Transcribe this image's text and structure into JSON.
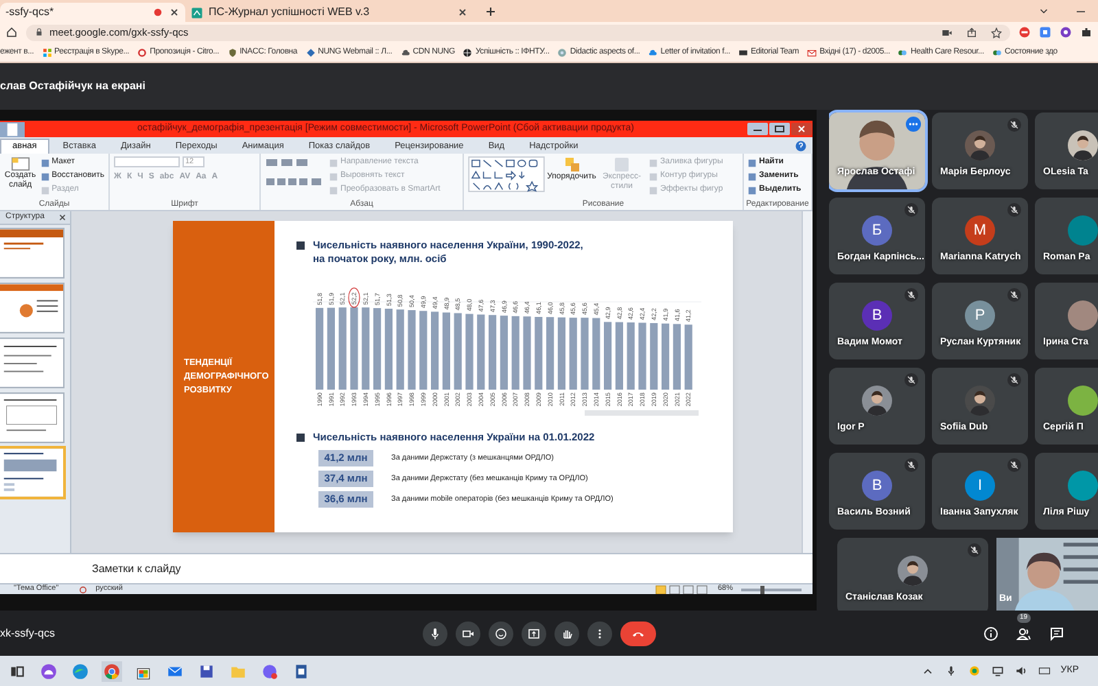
{
  "browser": {
    "tabs": [
      {
        "title": "-ssfy-qcs*",
        "recording": true,
        "selected": true
      },
      {
        "title": "ПС-Журнал успішності WEB v.3",
        "recording": false,
        "selected": false
      }
    ],
    "address": "meet.google.com/gxk-ssfy-qcs",
    "bookmarks": [
      "ежент в...",
      "Реєстрація в Skype...",
      "Пропозиція - Citro...",
      "INACC: Головна",
      "NUNG Webmail :: Л...",
      "CDN NUNG",
      "Успішність :: ІФНТУ...",
      "Didactic aspects of...",
      "Letter of invitation f...",
      "Editorial Team",
      "Вхідні (17) - d2005...",
      "Health Care Resour...",
      "Состояние здо"
    ]
  },
  "meet": {
    "presenting_label": "слав Остафійчук на екрані",
    "meeting_code": "xk-ssfy-qcs",
    "participant_count": "19",
    "participants": [
      {
        "name": "Ярослав Остафі",
        "kind": "video",
        "selected": true
      },
      {
        "name": "Марія Берлоус",
        "muted": true,
        "selected": false
      },
      {
        "name": "OLesia Ta",
        "selected": false
      },
      {
        "name": "Богдан Карпінсь...",
        "kind": "letter",
        "initial": "Б",
        "color": "#5c6bc0",
        "muted": true,
        "selected": false
      },
      {
        "name": "Marianna Katrych",
        "kind": "letter",
        "initial": "M",
        "color": "#c53d1b",
        "muted": true,
        "selected": false
      },
      {
        "name": "Roman Pa",
        "kind": "letter",
        "color": "#00838f",
        "selected": false
      },
      {
        "name": "Вадим Момот",
        "kind": "letter",
        "initial": "В",
        "color": "#5b2fb5",
        "muted": true,
        "selected": false
      },
      {
        "name": "Руслан Куртяник",
        "kind": "letter",
        "initial": "Р",
        "color": "#78909c",
        "muted": true,
        "selected": false
      },
      {
        "name": "Ірина Ста",
        "kind": "letter",
        "color": "#a1887f",
        "selected": false
      },
      {
        "name": "Igor P",
        "muted": true,
        "selected": false
      },
      {
        "name": "Sofiia Dub",
        "muted": true,
        "selected": false
      },
      {
        "name": "Сергій П",
        "kind": "letter",
        "color": "#7cb342",
        "selected": false
      },
      {
        "name": "Василь Возний",
        "kind": "letter",
        "initial": "В",
        "color": "#5c6bc0",
        "muted": true,
        "selected": false
      },
      {
        "name": "Іванна Запухляк",
        "kind": "letter",
        "initial": "І",
        "color": "#0288d1",
        "muted": true,
        "selected": false
      },
      {
        "name": "Ліля Рішу",
        "kind": "letter",
        "color": "#0097a7",
        "selected": false
      },
      {
        "name": "Станіслав Козак",
        "muted": true,
        "selected": false,
        "wide": true
      }
    ],
    "self_view": {
      "label": "Ви"
    }
  },
  "powerpoint": {
    "title": "остафійчук_демографія_презентація [Режим совместимости] - Microsoft PowerPoint (Сбой активации продукта)",
    "ribbon_tabs": [
      {
        "label": "авная",
        "selected": true
      },
      {
        "label": "Вставка",
        "selected": false
      },
      {
        "label": "Дизайн",
        "selected": false
      },
      {
        "label": "Переходы",
        "selected": false
      },
      {
        "label": "Анимация",
        "selected": false
      },
      {
        "label": "Показ слайдов",
        "selected": false
      },
      {
        "label": "Рецензирование",
        "selected": false
      },
      {
        "label": "Вид",
        "selected": false
      },
      {
        "label": "Надстройки",
        "selected": false
      }
    ],
    "slides_group": {
      "new_slide": "Создать слайд",
      "buttons": [
        {
          "label": "Макет",
          "disabled": false
        },
        {
          "label": "Восстановить",
          "disabled": false
        },
        {
          "label": "Раздел",
          "disabled": true
        }
      ],
      "label": "Слайды"
    },
    "font_group": {
      "size": "12",
      "buttons": [
        "Ж",
        "К",
        "Ч",
        "S",
        "abc",
        "AV",
        "Aa",
        "A"
      ],
      "label": "Шрифт"
    },
    "paragraph_group": {
      "buttons": [
        {
          "label": "Направление текста",
          "disabled": true
        },
        {
          "label": "Выровнять текст",
          "disabled": true
        },
        {
          "label": "Преобразовать в SmartArt",
          "disabled": true
        }
      ],
      "label": "Абзац"
    },
    "drawing_group": {
      "arrange": "Упорядочить",
      "quick_styles": "Экспресс-стили",
      "buttons": [
        {
          "label": "Заливка фигуры",
          "disabled": true
        },
        {
          "label": "Контур фигуры",
          "disabled": true
        },
        {
          "label": "Эффекты фигур",
          "disabled": true
        }
      ],
      "label": "Рисование"
    },
    "editing_group": {
      "buttons": [
        "Найти",
        "Заменить",
        "Выделить"
      ],
      "label": "Редактирование"
    },
    "outline_tab": "Структура",
    "thumbnails": [
      {
        "selected": false
      },
      {
        "selected": false
      },
      {
        "selected": false
      },
      {
        "selected": false
      },
      {
        "selected": true
      }
    ],
    "slide": {
      "side_title": "ТЕНДЕНЦІЇ ДЕМОГРАФІЧНОГО РОЗВИТКУ",
      "heading_lines": [
        "Чисельність наявного населення України, 1990-2022,",
        "на початок року, млн. осіб"
      ],
      "chart_data": {
        "type": "bar",
        "categories": [
          "1990",
          "1991",
          "1992",
          "1993",
          "1994",
          "1995",
          "1996",
          "1997",
          "1998",
          "1999",
          "2000",
          "2001",
          "2002",
          "2003",
          "2004",
          "2005",
          "2006",
          "2007",
          "2008",
          "2009",
          "2010",
          "2011",
          "2012",
          "2013",
          "2014",
          "2015",
          "2016",
          "2017",
          "2018",
          "2019",
          "2020",
          "2021",
          "2022"
        ],
        "values": [
          51.8,
          51.9,
          52.1,
          52.2,
          52.1,
          51.7,
          51.3,
          50.8,
          50.4,
          49.9,
          49.4,
          48.9,
          48.5,
          48.0,
          47.6,
          47.3,
          46.9,
          46.6,
          46.4,
          46.1,
          46.0,
          45.8,
          45.6,
          45.6,
          45.4,
          42.9,
          42.8,
          42.6,
          42.4,
          42.2,
          41.9,
          41.6,
          41.2
        ],
        "value_labels": [
          "51,8",
          "51,9",
          "52,1",
          "52,2",
          "52,1",
          "51,7",
          "51,3",
          "50,8",
          "50,4",
          "49,9",
          "49,4",
          "48,9",
          "48,5",
          "48,0",
          "47,6",
          "47,3",
          "46,9",
          "46,6",
          "46,4",
          "46,1",
          "46,0",
          "45,8",
          "45,6",
          "45,6",
          "45,4",
          "42,9",
          "42,8",
          "42,6",
          "42,4",
          "42,2",
          "41,9",
          "41,6",
          "41,2"
        ],
        "data_labels": true
      },
      "circled_labels": [
        false,
        false,
        false,
        true,
        false,
        false,
        false,
        false,
        false,
        false,
        false,
        false,
        false,
        false,
        false,
        false,
        false,
        false,
        false,
        false,
        false,
        false,
        false,
        false,
        false,
        false,
        false,
        false,
        false,
        false,
        false,
        false,
        false
      ],
      "subheading": "Чисельність наявного населення України на 01.01.2022",
      "figures": [
        {
          "value": "41,2 млн",
          "note": "За даними Держстату (з мешканцями ОРДЛО)"
        },
        {
          "value": "37,4 млн",
          "note": "За даними Держстату (без мешканців Криму та ОРДЛО)"
        },
        {
          "value": "36,6 млн",
          "note": "За даними mobile операторів (без мешканців Криму та ОРДЛО)"
        }
      ]
    },
    "notes_placeholder": "Заметки к слайду",
    "status": {
      "theme": "\"Тема Office\"",
      "language": "русский",
      "zoom": "68%",
      "zoom_slider": {
        "level": 0.35
      }
    }
  },
  "taskbar": {
    "language": "УКР"
  }
}
